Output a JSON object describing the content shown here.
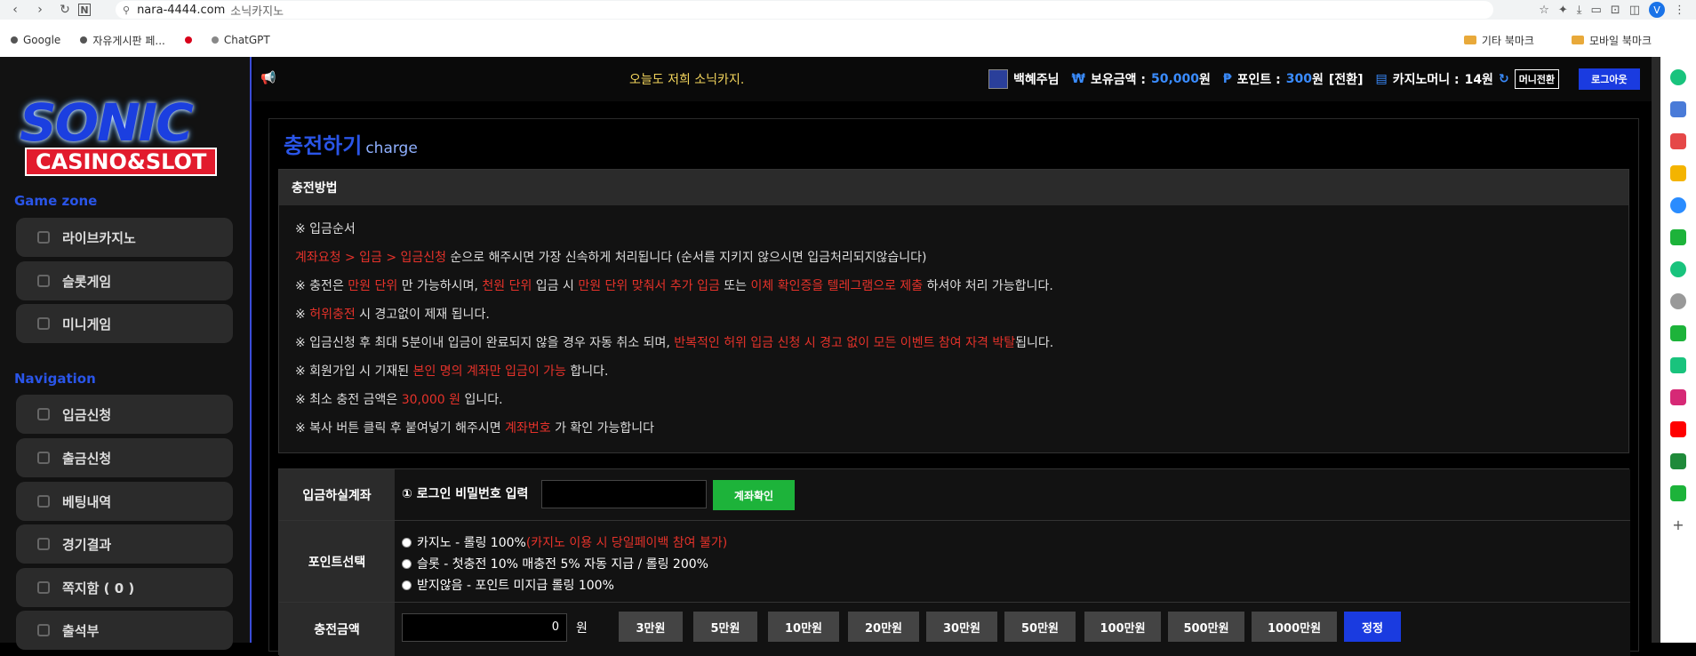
{
  "browser": {
    "url_host": "nara-4444.com",
    "url_title": "소닉카지노",
    "profile_initial": "V",
    "bookmarks": [
      {
        "label": "Google",
        "color": "#555555"
      },
      {
        "label": "자유게시판 페...",
        "color": "#555555"
      },
      {
        "label": "",
        "color": "#d8001a"
      },
      {
        "label": "ChatGPT",
        "color": "#888888"
      }
    ],
    "bookmark_folders": [
      "기타 북마크",
      "모바일 북마크"
    ]
  },
  "logo": {
    "line1": "SONIC",
    "line2": "CASINO&SLOT"
  },
  "sidebar": {
    "game_zone_title": "Game zone",
    "game_items": [
      "라이브카지노",
      "슬롯게임",
      "미니게임"
    ],
    "navigation_title": "Navigation",
    "nav_items": [
      "입금신청",
      "출금신청",
      "베팅내역",
      "경기결과",
      "쪽지함 ( 0 )",
      "출석부"
    ]
  },
  "topbar": {
    "marquee": "오늘도 저희 소닉카지.",
    "username": "백혜주님",
    "balance_label": "보유금액 :",
    "balance_value": "50,000",
    "balance_unit": "원",
    "point_label": "포인트 :",
    "point_value": "300",
    "point_unit": "원",
    "point_convert": "[전환]",
    "casino_label": "카지노머니 :",
    "casino_value": "14원",
    "money_convert_btn": "머니전환",
    "logout_btn": "로그아웃"
  },
  "page": {
    "title": "충전하기",
    "subtitle": "charge"
  },
  "method": {
    "header": "충전방법",
    "l1": "※ 입금순서",
    "l2a": "계좌요청 > 입금 > 입금신청",
    "l2b": " 순으로 해주시면 가장 신속하게 처리됩니다 (순서를 지키지 않으시면 입금처리되지않습니다)",
    "l3a": "※ 충전은 ",
    "l3b": "만원 단위",
    "l3c": " 만 가능하시며, ",
    "l3d": "천원 단위",
    "l3e": " 입금 시 ",
    "l3f": "만원 단위 맞춰서 추가 입금",
    "l3g": " 또는 ",
    "l3h": "이체 확인증을 텔레그램으로 제출",
    "l3i": " 하셔야 처리 가능합니다.",
    "l4a": "※ ",
    "l4b": "허위충전",
    "l4c": " 시 경고없이 제재 됩니다.",
    "l5a": "※ 입금신청 후 최대 5분이내 입금이 완료되지 않을 경우 자동 취소 되며, ",
    "l5b": "반복적인 허위 입금 신청 시 경고 없이 모든 이벤트 참여 자격 박탈",
    "l5c": "됩니다.",
    "l6a": "※ 회원가입 시 기재된 ",
    "l6b": "본인 명의 계좌만 입금이 가능",
    "l6c": " 합니다.",
    "l7a": "※ 최소 충전 금액은 ",
    "l7b": "30,000 원",
    "l7c": " 입니다.",
    "l8a": "※ 복사 버튼 클릭 후 붙여넣기 해주시면 ",
    "l8b": "계좌번호",
    "l8c": " 가 확인 가능합니다"
  },
  "form": {
    "account_label": "입금하실계좌",
    "pw_label": "① 로그인 비밀번호 입력",
    "check_btn": "계좌확인",
    "point_label": "포인트선택",
    "opt1a": "카지노 - 롤링 100% ",
    "opt1b": "(카지노 이용 시 당일페이백 참여 불가)",
    "opt2": "슬롯 - 첫충전 10% 매충전 5% 자동 지급 / 롤링 200%",
    "opt3": "받지않음 - 포인트 미지급 롤링 100%",
    "amount_label": "충전금액",
    "amount_value": "0",
    "amount_unit": "원",
    "amount_buttons": [
      "3만원",
      "5만원",
      "10만원",
      "20만원",
      "30만원",
      "50만원",
      "100만원",
      "500만원",
      "1000만원"
    ],
    "reset_btn": "정정"
  },
  "colors": {
    "accent_blue": "#2a55e8",
    "warning_red": "#e5322a",
    "confirm_green": "#1db33a"
  }
}
